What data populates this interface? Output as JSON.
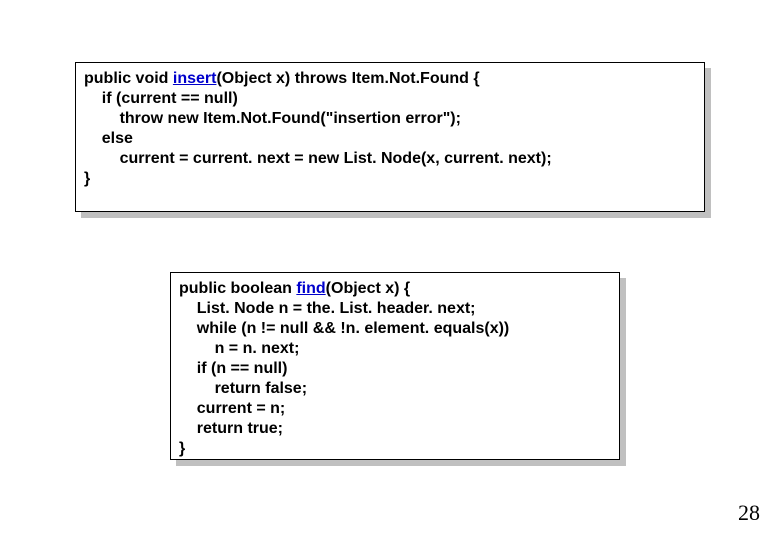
{
  "page_number": "28",
  "box1": {
    "l0_pre": "public void ",
    "l0_name": "insert",
    "l0_post": "(Object x) throws Item.Not.Found {",
    "l1": "    if (current == null)",
    "l2": "        throw new Item.Not.Found(\"insertion error\");",
    "l3": "    else",
    "l4": "        current = current. next = new List. Node(x, current. next);",
    "l5": "}"
  },
  "box2": {
    "l0_pre": "public boolean ",
    "l0_name": "find",
    "l0_post": "(Object x) {",
    "l1": "    List. Node n = the. List. header. next;",
    "l2": "    while (n != null && !n. element. equals(x))",
    "l3": "        n = n. next;",
    "l4": "    if (n == null)",
    "l5": "        return false;",
    "l6": "    current = n;",
    "l7": "    return true;",
    "l8": "}"
  }
}
